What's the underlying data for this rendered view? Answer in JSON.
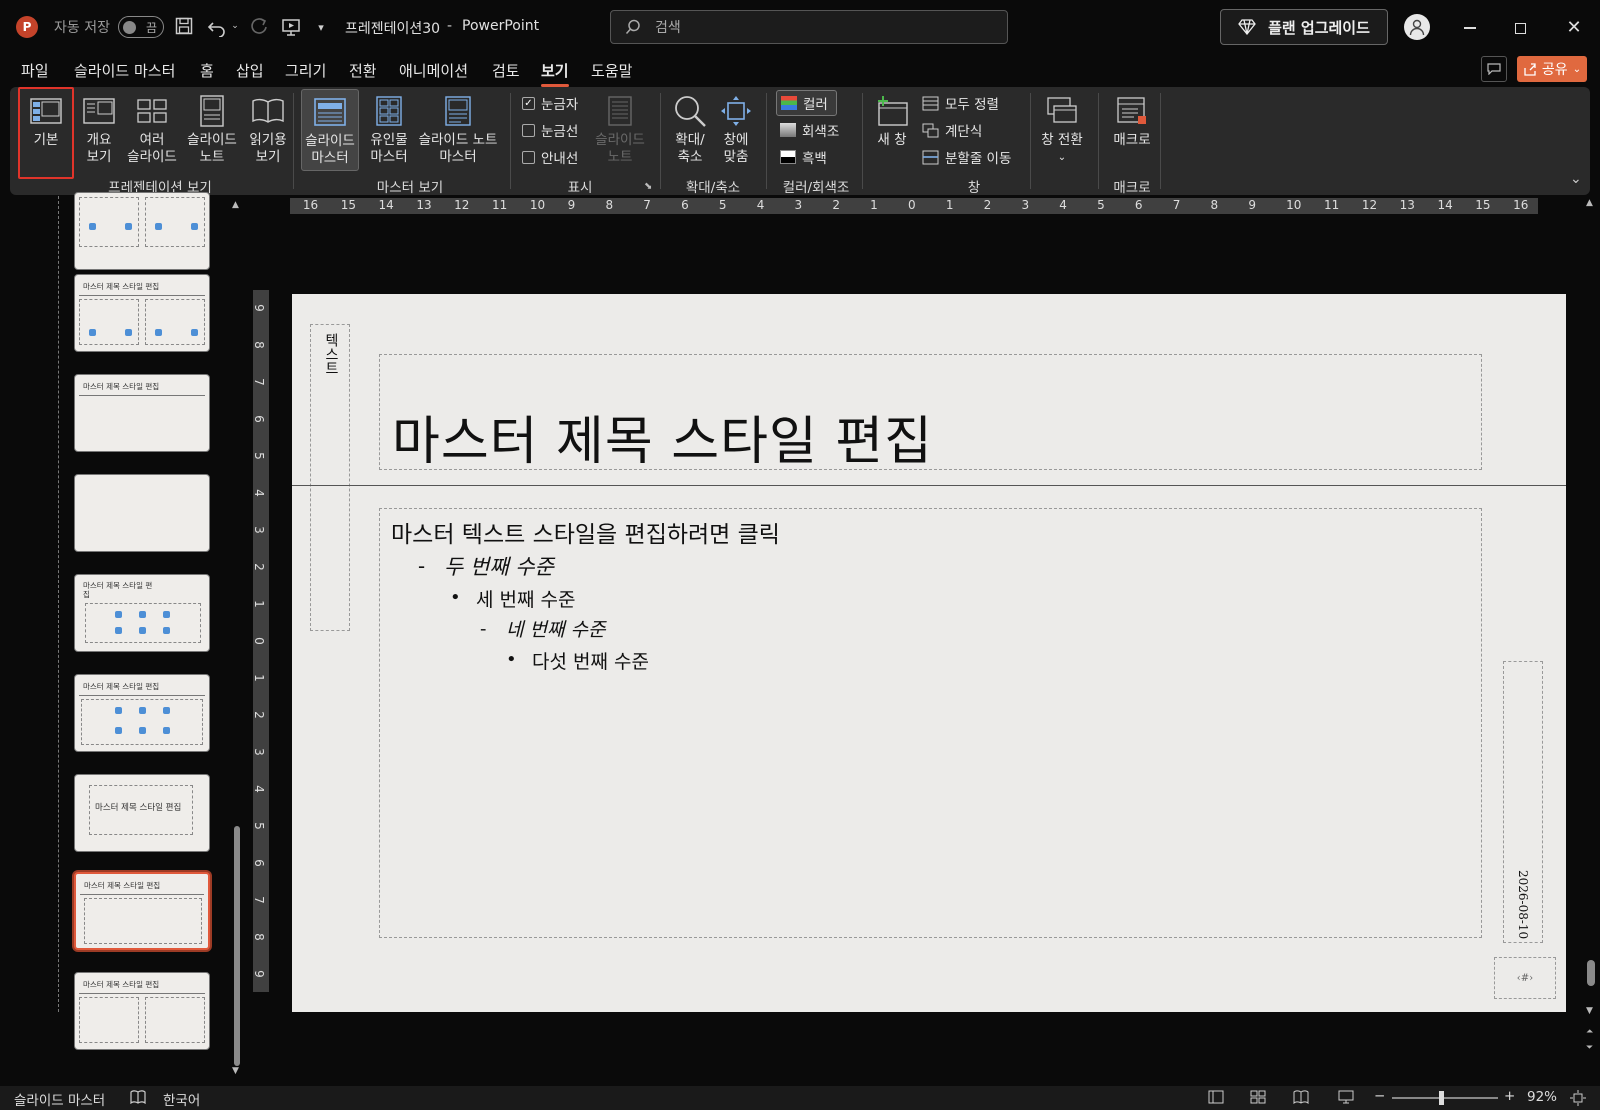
{
  "titlebar": {
    "autosave_label": "자동 저장",
    "autosave_state": "끔",
    "document_title": "프레젠테이션30",
    "separator": "-",
    "app_name": "PowerPoint",
    "search_placeholder": "검색",
    "upgrade_label": "플랜 업그레이드"
  },
  "tabs": [
    {
      "label": "파일"
    },
    {
      "label": "슬라이드 마스터"
    },
    {
      "label": "홈"
    },
    {
      "label": "삽입"
    },
    {
      "label": "그리기"
    },
    {
      "label": "전환"
    },
    {
      "label": "애니메이션"
    },
    {
      "label": "검토"
    },
    {
      "label": "보기",
      "active": true
    },
    {
      "label": "도움말"
    }
  ],
  "share_label": "공유",
  "ribbon": {
    "presentation_views": {
      "group_label": "프레젠테이션 보기",
      "normal": "기본",
      "outline_1": "개요",
      "outline_2": "보기",
      "sorter_1": "여러",
      "sorter_2": "슬라이드",
      "notes_1": "슬라이드",
      "notes_2": "노트",
      "reading_1": "읽기용",
      "reading_2": "보기"
    },
    "master_views": {
      "group_label": "마스터 보기",
      "slide_master_1": "슬라이드",
      "slide_master_2": "마스터",
      "handout_1": "유인물",
      "handout_2": "마스터",
      "notes_master_1": "슬라이드 노트",
      "notes_master_2": "마스터"
    },
    "show": {
      "group_label": "표시",
      "ruler": "눈금자",
      "ruler_checked": true,
      "gridlines": "눈금선",
      "guides": "안내선",
      "notes_1": "슬라이드",
      "notes_2": "노트"
    },
    "zoom": {
      "group_label": "확대/축소",
      "zoom_1": "확대/",
      "zoom_2": "축소",
      "fit_1": "창에",
      "fit_2": "맞춤"
    },
    "color": {
      "group_label": "컬러/회색조",
      "color": "컬러",
      "grayscale": "회색조",
      "bw": "흑백"
    },
    "window": {
      "group_label": "창",
      "new_window": "새 창",
      "arrange_all": "모두 정렬",
      "cascade": "계단식",
      "move_split": "분할줄 이동",
      "switch_windows": "창 전환"
    },
    "macros": {
      "group_label": "매크로",
      "macros": "매크로"
    }
  },
  "thumbnails": [
    {
      "title": "",
      "selected": false
    },
    {
      "title": "마스터 제목 스타일 편집",
      "selected": false
    },
    {
      "title": "마스터 제목 스타일 편집",
      "selected": false
    },
    {
      "title": "",
      "selected": false
    },
    {
      "title": "마스터 제목 스타일 편집",
      "selected": false
    },
    {
      "title": "마스터 제목 스타일 편집",
      "selected": false
    },
    {
      "title": "마스터 제목 스타일 편집",
      "selected": false
    },
    {
      "title": "마스터 제목 스타일 편집",
      "selected": true
    },
    {
      "title": "마스터 제목 스타일 편집",
      "selected": false
    }
  ],
  "ruler": {
    "horizontal": [
      "16",
      "15",
      "14",
      "13",
      "12",
      "11",
      "10",
      "9",
      "8",
      "7",
      "6",
      "5",
      "4",
      "3",
      "2",
      "1",
      "0",
      "1",
      "2",
      "3",
      "4",
      "5",
      "6",
      "7",
      "8",
      "9",
      "10",
      "11",
      "12",
      "13",
      "14",
      "15",
      "16"
    ],
    "vertical": [
      "9",
      "8",
      "7",
      "6",
      "5",
      "4",
      "3",
      "2",
      "1",
      "0",
      "1",
      "2",
      "3",
      "4",
      "5",
      "6",
      "7",
      "8",
      "9"
    ]
  },
  "slide": {
    "title": "마스터 제목 스타일 편집",
    "level1": "마스터 텍스트 스타일을 편집하려면 클릭",
    "level2": "두 번째 수준",
    "level3": "세 번째 수준",
    "level4": "네 번째 수준",
    "level5": "다섯 번째 수준",
    "dash": "-",
    "bullet": "•",
    "vertical_label": "텍스트",
    "date": "2026-08-10",
    "slide_number": "‹#›"
  },
  "statusbar": {
    "view_label": "슬라이드 마스터",
    "language": "한국어",
    "zoom_minus": "−",
    "zoom_plus": "+",
    "zoom_percent": "92%",
    "zoom_level": 0.92
  },
  "colors": {
    "accent": "#e0593b",
    "share_bg": "#e0693f",
    "highlight_box": "#e0342a"
  }
}
